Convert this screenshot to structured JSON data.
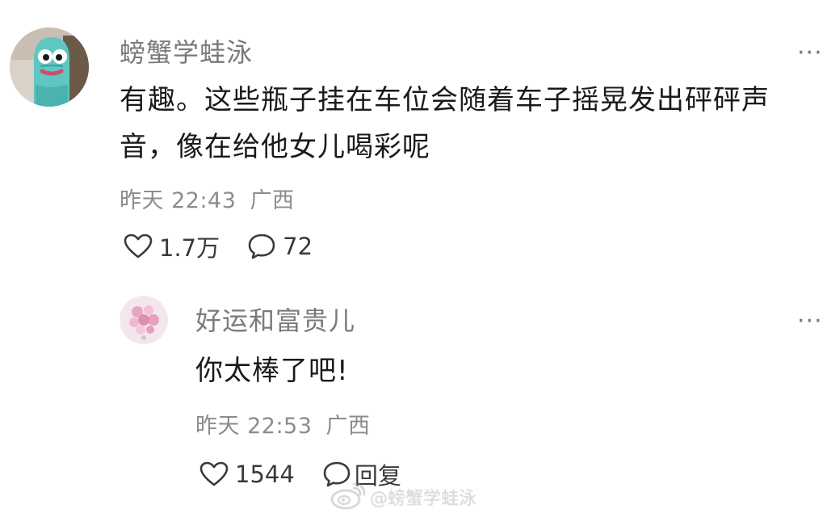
{
  "comment": {
    "username": "螃蟹学蛙泳",
    "text": "有趣。这些瓶子挂在车位会随着车子摇晃发出砰砰声音，像在给他女儿喝彩呢",
    "time": "昨天 22:43",
    "location": "广西",
    "likes": "1.7万",
    "replies": "72",
    "more_label": "···",
    "avatar_icon": "blue-cartoon-character"
  },
  "reply": {
    "username": "好运和富贵儿",
    "text": "你太棒了吧!",
    "time": "昨天 22:53",
    "location": "广西",
    "likes": "1544",
    "reply_label": "回复",
    "more_label": "···",
    "avatar_icon": "pink-flower-bouquet"
  },
  "watermark": {
    "logo_icon": "weibo-logo",
    "text": "@螃蟹学蛙泳"
  }
}
